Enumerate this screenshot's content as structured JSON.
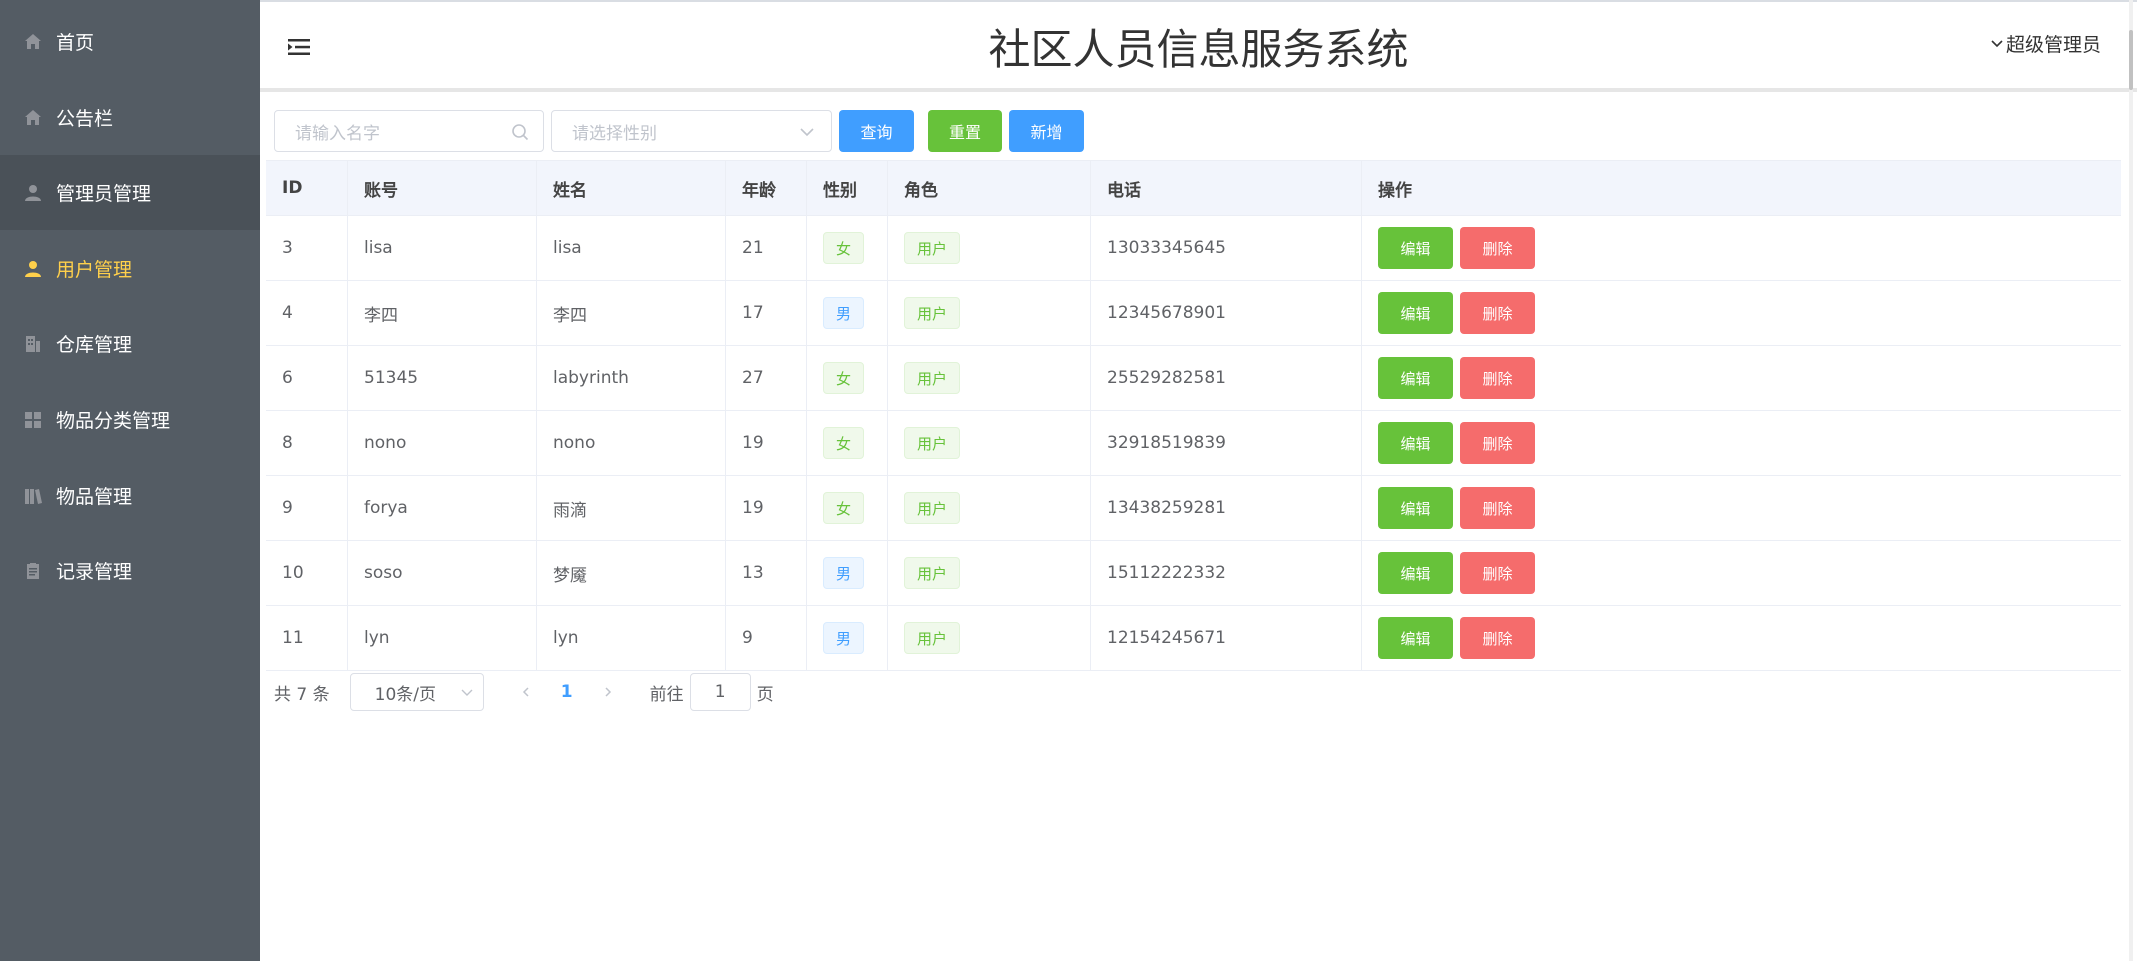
{
  "sidebar": {
    "items": [
      {
        "label": "首页",
        "icon": "home-icon"
      },
      {
        "label": "公告栏",
        "icon": "home-icon"
      },
      {
        "label": "管理员管理",
        "icon": "user-icon"
      },
      {
        "label": "用户管理",
        "icon": "user-icon",
        "active": true
      },
      {
        "label": "仓库管理",
        "icon": "office-building-icon"
      },
      {
        "label": "物品分类管理",
        "icon": "grid-icon"
      },
      {
        "label": "物品管理",
        "icon": "collection-icon"
      },
      {
        "label": "记录管理",
        "icon": "clipboard-icon"
      }
    ],
    "colors": {
      "background": "#545c64",
      "active": "#ffd04b"
    }
  },
  "header": {
    "title": "社区人员信息服务系统",
    "user": "超级管理员"
  },
  "filters": {
    "name_placeholder": "请输入名字",
    "gender_placeholder": "请选择性别",
    "search_label": "查询",
    "reset_label": "重置",
    "add_label": "新增"
  },
  "table": {
    "columns": [
      "ID",
      "账号",
      "姓名",
      "年龄",
      "性别",
      "角色",
      "电话",
      "操作"
    ],
    "rows": [
      {
        "id": "3",
        "account": "lisa",
        "name": "lisa",
        "age": "21",
        "gender": "女",
        "role": "用户",
        "phone": "13033345645"
      },
      {
        "id": "4",
        "account": "李四",
        "name": "李四",
        "age": "17",
        "gender": "男",
        "role": "用户",
        "phone": "12345678901"
      },
      {
        "id": "6",
        "account": "51345",
        "name": "labyrinth",
        "age": "27",
        "gender": "女",
        "role": "用户",
        "phone": "25529282581"
      },
      {
        "id": "8",
        "account": "nono",
        "name": "nono",
        "age": "19",
        "gender": "女",
        "role": "用户",
        "phone": "32918519839"
      },
      {
        "id": "9",
        "account": "forya",
        "name": "雨滴",
        "age": "19",
        "gender": "女",
        "role": "用户",
        "phone": "13438259281"
      },
      {
        "id": "10",
        "account": "soso",
        "name": "梦魇",
        "age": "13",
        "gender": "男",
        "role": "用户",
        "phone": "15112222332"
      },
      {
        "id": "11",
        "account": "lyn",
        "name": "lyn",
        "age": "9",
        "gender": "男",
        "role": "用户",
        "phone": "12154245671"
      }
    ],
    "edit_label": "编辑",
    "delete_label": "删除"
  },
  "pagination": {
    "total": "共 7 条",
    "page_size": "10条/页",
    "current_page": "1",
    "goto_prefix": "前往",
    "goto_value": "1",
    "goto_suffix": "页"
  },
  "colors": {
    "primary": "#409eff",
    "success": "#67c23a",
    "danger": "#f56c6c"
  }
}
